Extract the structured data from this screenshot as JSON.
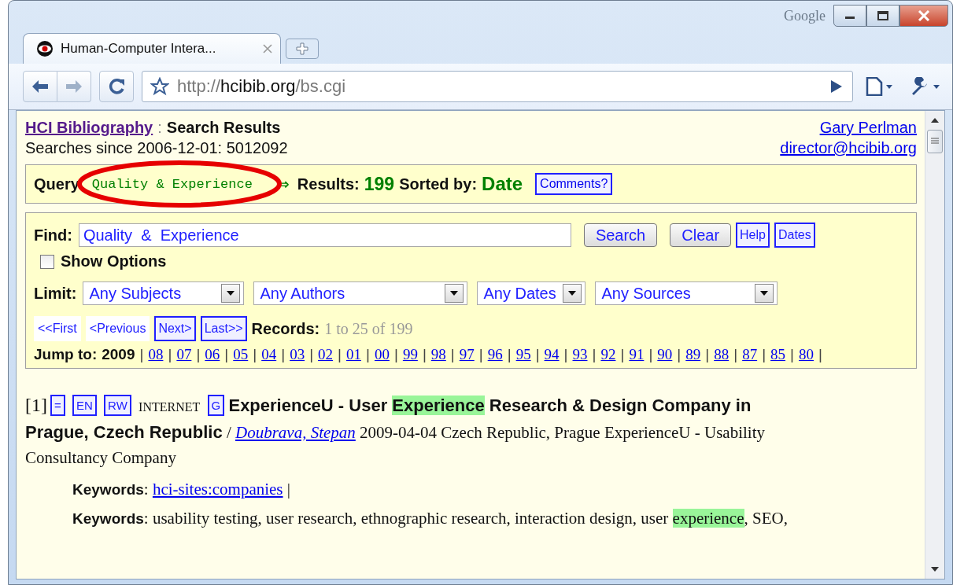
{
  "browser": {
    "brand": "Google",
    "tabs": [
      {
        "title": "Human-Computer Intera...",
        "selected": true
      }
    ],
    "address": {
      "scheme": "http://",
      "host": "hcibib.org",
      "path": "/bs.cgi"
    }
  },
  "header": {
    "site_link": "HCI Bibliography",
    "separator": ":",
    "title": "Search Results",
    "stats": "Searches since 2006-12-01: 5012092",
    "contact_name": "Gary Perlman",
    "contact_email": "director@hcibib.org"
  },
  "query_bar": {
    "label": "Query",
    "query": "Quality & Experience",
    "arrow": "⇒",
    "results_label": "Results:",
    "results_count": "199",
    "sorted_label": "Sorted by:",
    "sorted_value": "Date",
    "comments_button": "Comments?",
    "annotation": {
      "kind": "ellipse"
    }
  },
  "search_form": {
    "find_label": "Find:",
    "find_value": "Quality  &  Experience",
    "buttons": [
      {
        "label": "Search",
        "kind": "push"
      },
      {
        "label": "Clear",
        "kind": "push"
      },
      {
        "label": "Help",
        "kind": "small"
      },
      {
        "label": "Dates",
        "kind": "small"
      }
    ],
    "show_options": {
      "label": "Show Options",
      "checked": false
    },
    "limit_label": "Limit:",
    "dropdowns": [
      "Any Subjects",
      "Any Authors",
      "Any Dates",
      "Any Sources"
    ],
    "pager": [
      {
        "label": "<<First",
        "disabled": true
      },
      {
        "label": "<Previous",
        "disabled": true
      },
      {
        "label": "Next>",
        "disabled": false
      },
      {
        "label": "Last>>",
        "disabled": false
      }
    ],
    "records_label": "Records:",
    "records_text": "1 to 25 of 199",
    "jump_label": "Jump to:",
    "jump_current": "2009",
    "separator": "|",
    "jump_links": [
      "08",
      "07",
      "06",
      "05",
      "04",
      "03",
      "02",
      "01",
      "00",
      "99",
      "98",
      "97",
      "96",
      "95",
      "94",
      "93",
      "92",
      "91",
      "90",
      "89",
      "88",
      "87",
      "85",
      "80"
    ]
  },
  "results": [
    {
      "index": "[1]",
      "tags": [
        {
          "label": "=",
          "kind": "button"
        },
        {
          "label": "EN",
          "kind": "button"
        },
        {
          "label": "RW",
          "kind": "button"
        },
        {
          "label": "INTERNET",
          "kind": "text"
        },
        {
          "label": "G",
          "kind": "button"
        }
      ],
      "title_lines": [
        [
          {
            "text": "ExperienceU - User ",
            "highlighted": false
          },
          {
            "text": "Experience",
            "highlighted": true
          },
          {
            "text": " Research & Design Company in",
            "highlighted": false
          }
        ],
        [
          {
            "text": "Prague, Czech Republic",
            "highlighted": false
          }
        ]
      ],
      "slash": "/",
      "author": "Doubrava, Stepan",
      "description_lines": [
        "2009-04-04 Czech Republic, Prague ExperienceU - Usability",
        "Consultancy Company"
      ],
      "keyword_lines": [
        {
          "kind": "links",
          "label": "**Keywords**:",
          "links": [
            "hci-sites:companies"
          ],
          "trailer": "|"
        },
        {
          "kind": "text",
          "parts": [
            {
              "text": "**Keywords**: usability testing, user research, ethnographic research, interaction design, user ",
              "highlighted": false
            },
            {
              "text": "experience",
              "highlighted": true
            },
            {
              "text": ", SEO,",
              "highlighted": false
            }
          ]
        }
      ]
    }
  ]
}
